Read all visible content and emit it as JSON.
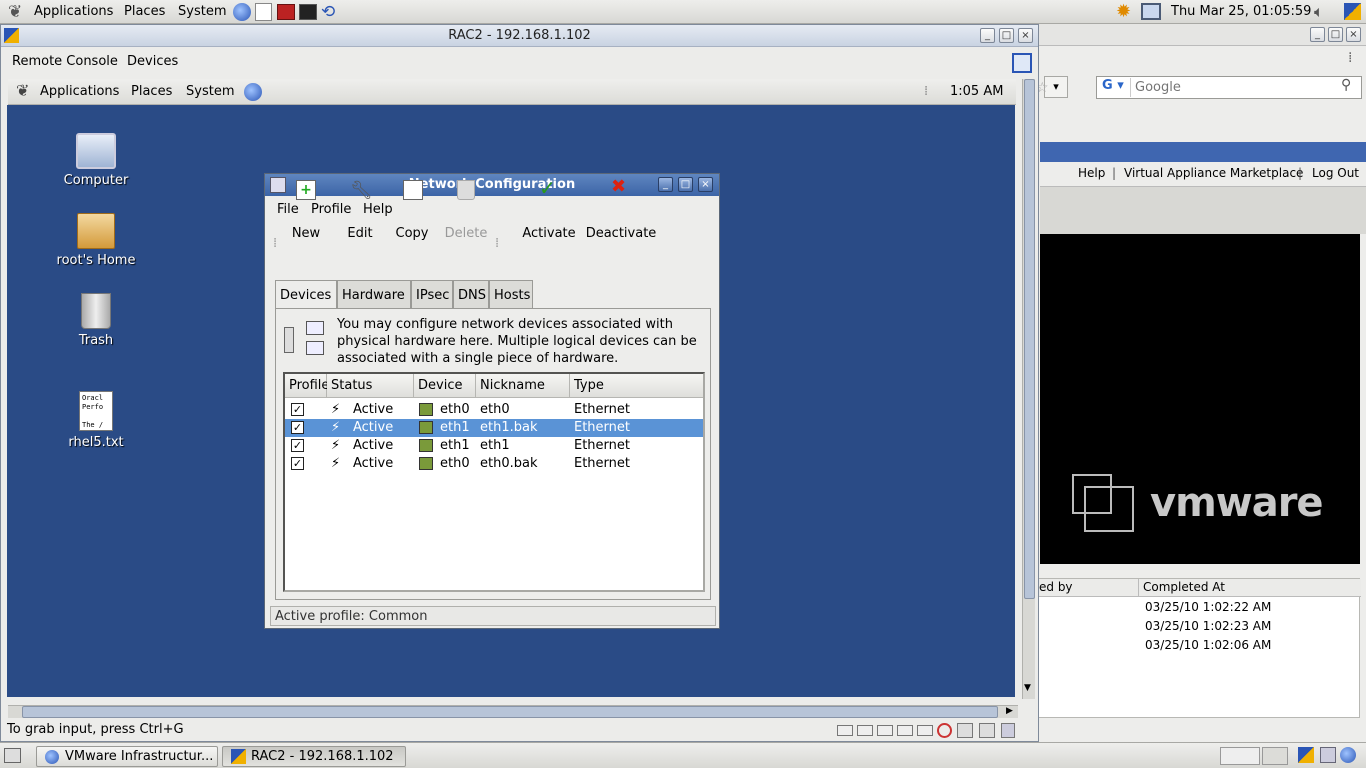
{
  "top_panel": {
    "applications": "Applications",
    "places": "Places",
    "system": "System",
    "clock": "Thu Mar 25, 01:05:59"
  },
  "browser": {
    "search_placeholder": "Google",
    "links": [
      "Help",
      "Virtual Appliance Marketplace",
      "Log Out"
    ],
    "logo_text": "vmware",
    "table_headers": [
      "ed by",
      "Completed At"
    ],
    "table_rows": [
      "03/25/10 1:02:22 AM",
      "03/25/10 1:02:23 AM",
      "03/25/10 1:02:06 AM"
    ]
  },
  "console": {
    "title": "RAC2 - 192.168.1.102",
    "menu": [
      "Remote Console",
      "Devices"
    ],
    "inner_panel": {
      "applications": "Applications",
      "places": "Places",
      "system": "System",
      "clock": "1:05 AM"
    },
    "status_hint": "To grab input, press Ctrl+G"
  },
  "desktop_icons": [
    "Computer",
    "root's Home",
    "Trash",
    "rhel5.txt"
  ],
  "rhel_preview": "Oracl\nPerfo\n\nThe /",
  "netconf": {
    "title": "Network Configuration",
    "menu": [
      "File",
      "Profile",
      "Help"
    ],
    "toolbar": [
      "New",
      "Edit",
      "Copy",
      "Delete",
      "Activate",
      "Deactivate"
    ],
    "tabs": [
      "Devices",
      "Hardware",
      "IPsec",
      "DNS",
      "Hosts"
    ],
    "description": "You may configure network devices associated with physical hardware here.  Multiple logical devices can be associated with a single piece of hardware.",
    "columns": [
      "Profile",
      "Status",
      "Device",
      "Nickname",
      "Type"
    ],
    "rows": [
      {
        "status": "Active",
        "device": "eth0",
        "nickname": "eth0",
        "type": "Ethernet"
      },
      {
        "status": "Active",
        "device": "eth1",
        "nickname": "eth1.bak",
        "type": "Ethernet"
      },
      {
        "status": "Active",
        "device": "eth1",
        "nickname": "eth1",
        "type": "Ethernet"
      },
      {
        "status": "Active",
        "device": "eth0",
        "nickname": "eth0.bak",
        "type": "Ethernet"
      }
    ],
    "active_profile": "Active profile: Common"
  },
  "taskbar": [
    "VMware Infrastructur...",
    "RAC2 - 192.168.1.102"
  ]
}
